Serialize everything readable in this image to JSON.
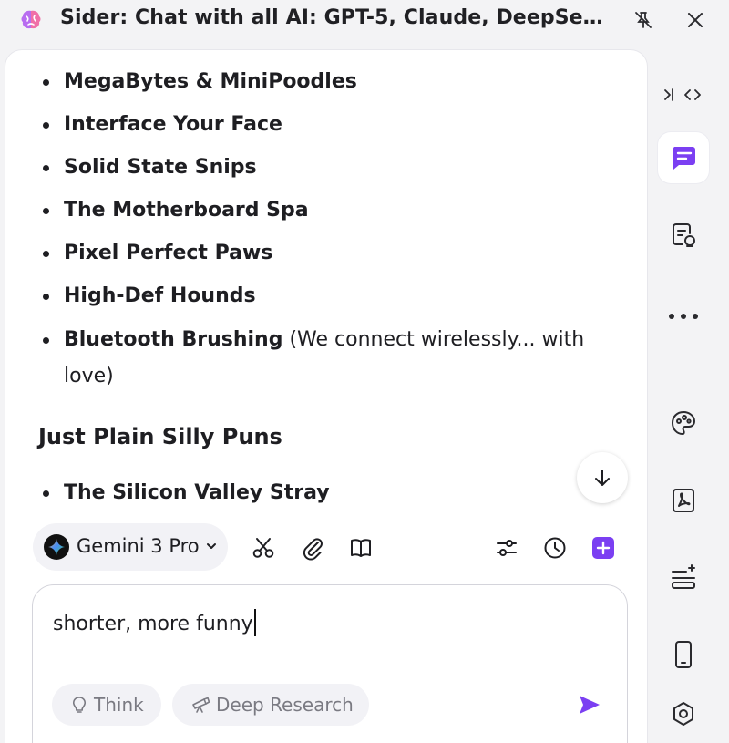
{
  "window": {
    "title": "Sider: Chat with all AI: GPT-5, Claude, DeepSeek..."
  },
  "chat": {
    "list_items": [
      {
        "bold": "MegaBytes & MiniPoodles",
        "rest": ""
      },
      {
        "bold": "Interface Your Face",
        "rest": ""
      },
      {
        "bold": "Solid State Snips",
        "rest": ""
      },
      {
        "bold": "The Motherboard Spa",
        "rest": ""
      },
      {
        "bold": "Pixel Perfect Paws",
        "rest": ""
      },
      {
        "bold": "High-Def Hounds",
        "rest": ""
      },
      {
        "bold": "Bluetooth Brushing",
        "rest": " (We connect wirelessly... with love)"
      }
    ],
    "section_heading": "Just Plain Silly Puns",
    "section_items": [
      {
        "bold": "The Silicon Valley Stray",
        "rest": ""
      }
    ]
  },
  "toolbar": {
    "model_name": "Gemini 3 Pro"
  },
  "input": {
    "value": "shorter, more funny",
    "think_label": "Think",
    "deep_research_label": "Deep Research"
  },
  "colors": {
    "accent": "#7b3ff2",
    "text": "#1e1e22",
    "muted": "#7a7a82"
  },
  "icons": {
    "sidebar": [
      "chat-icon",
      "file-chat-icon",
      "more-icon",
      "palette-icon",
      "pdf-icon",
      "sparkle-list-icon",
      "mobile-icon",
      "hexagon-icon"
    ],
    "toolbar": [
      "scissors-icon",
      "paperclip-icon",
      "book-icon",
      "sliders-icon",
      "clock-icon",
      "new-chat-icon"
    ]
  }
}
